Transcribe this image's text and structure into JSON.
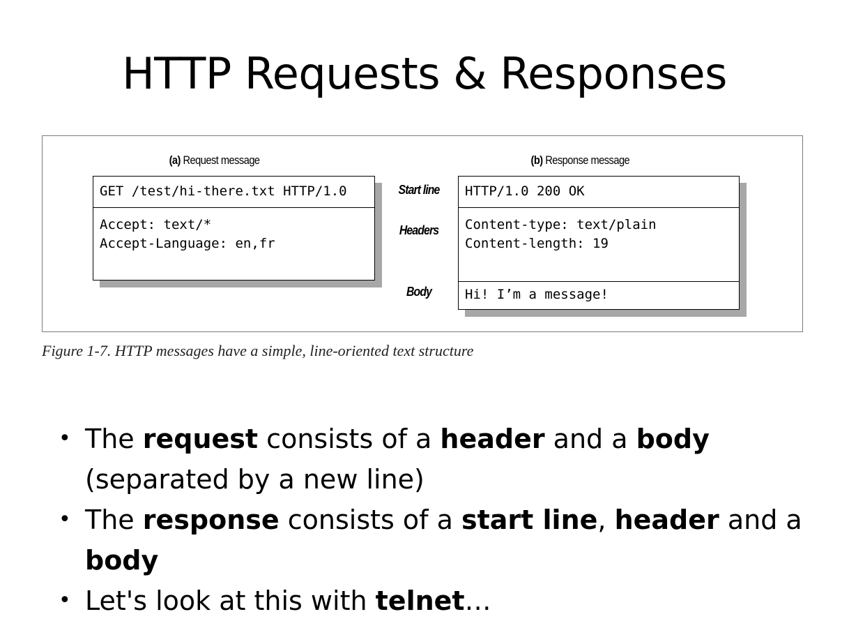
{
  "slide": {
    "title": "HTTP Requests & Responses",
    "figure_caption": "Figure 1-7. HTTP messages have a simple, line-oriented text structure"
  },
  "figure": {
    "request": {
      "label_prefix": "(a)",
      "label_text": " Request message",
      "start_line": "GET /test/hi-there.txt HTTP/1.0",
      "headers": "Accept: text/*\nAccept-Language: en,fr"
    },
    "response": {
      "label_prefix": "(b)",
      "label_text": " Response message",
      "start_line": "HTTP/1.0 200 OK",
      "headers": "Content-type: text/plain\nContent-length: 19",
      "body": "Hi! I’m a message!"
    },
    "row_labels": {
      "start_line": "Start line",
      "headers": "Headers",
      "body": "Body"
    }
  },
  "bullets": {
    "b1": {
      "t1": "The ",
      "b1": "request",
      "t2": " consists of a ",
      "b2": "header",
      "t3": " and a ",
      "b3": "body",
      "t4": " (separated by a new line)"
    },
    "b2": {
      "t1": "The ",
      "b1": "response",
      "t2": " consists of a ",
      "b2": "start line",
      "t3": ", ",
      "b3": "header",
      "t4": " and a ",
      "b4": "body"
    },
    "b3": {
      "t1": "Let's look at this with ",
      "b1": "telnet",
      "t2": "…"
    },
    "bullet_glyph": "•"
  }
}
